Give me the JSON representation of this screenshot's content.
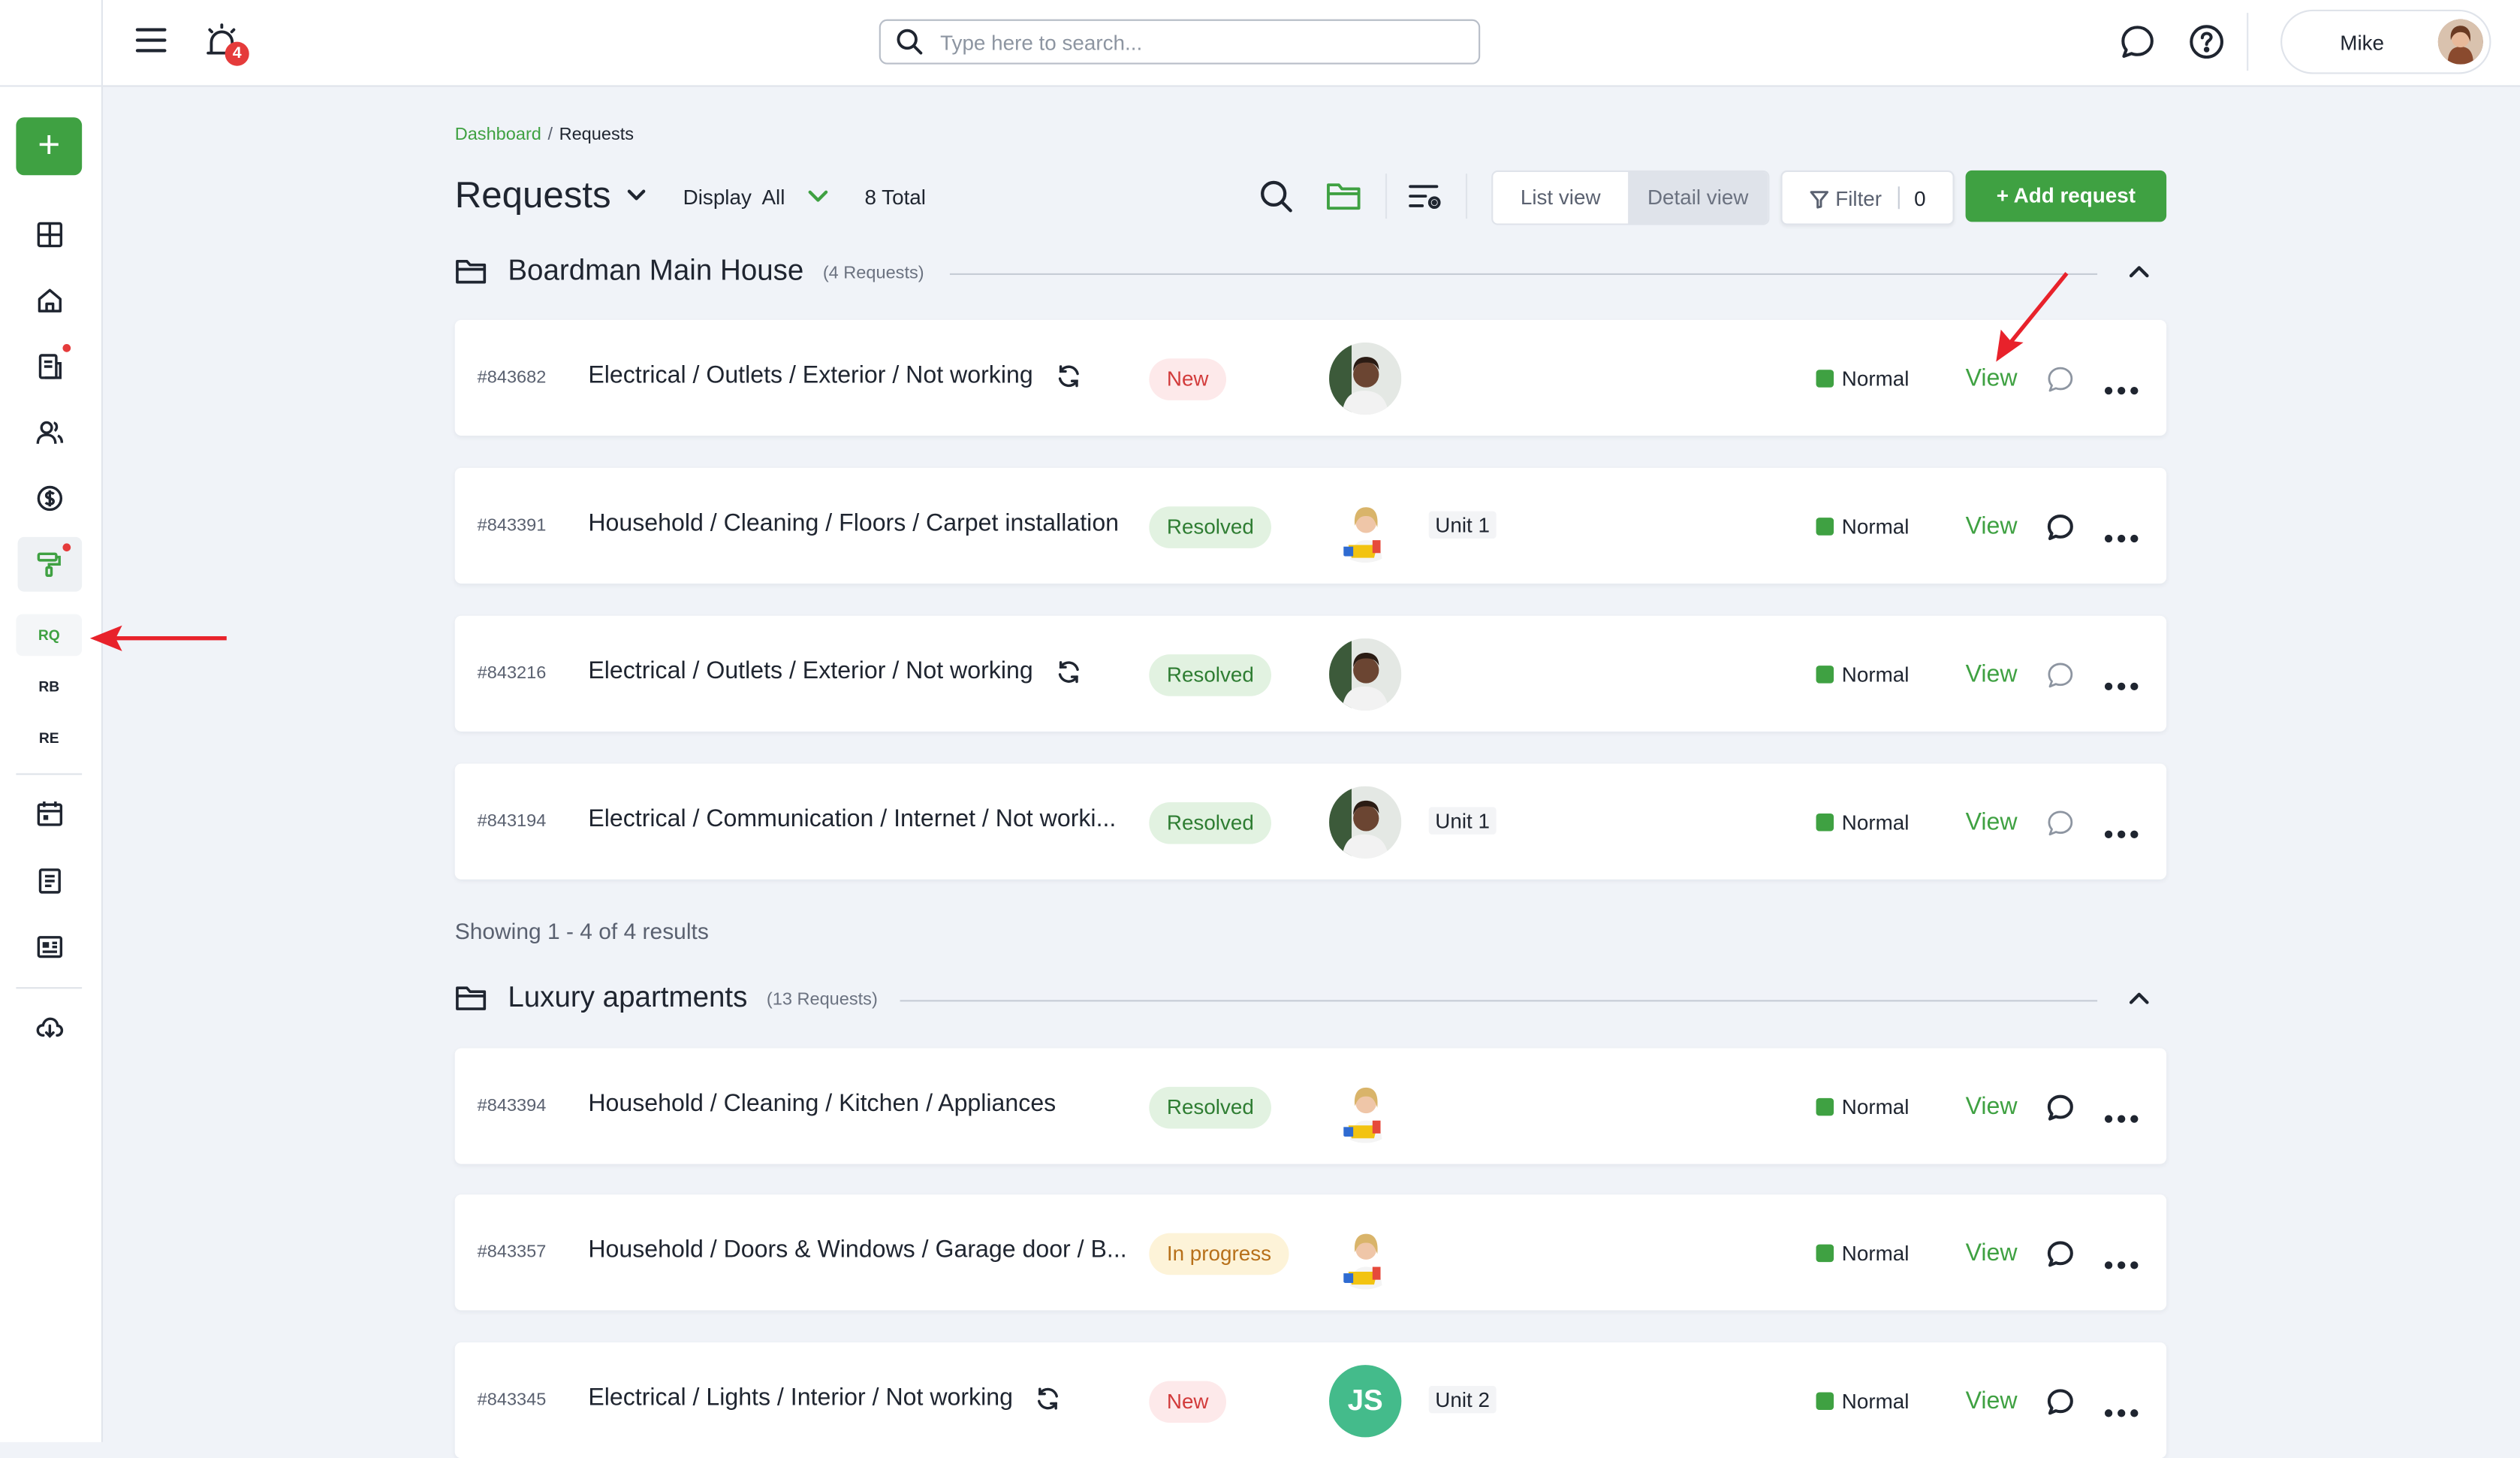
{
  "header": {
    "notification_count": "4",
    "search_placeholder": "Type here to search...",
    "user_name": "Mike"
  },
  "sidebar": {
    "add_label": "+",
    "sub_items": [
      "RQ",
      "RB",
      "RE"
    ],
    "active_sub": "RQ"
  },
  "breadcrumb": {
    "home": "Dashboard",
    "separator": "/",
    "current": "Requests"
  },
  "toolbar": {
    "title": "Requests",
    "display_label": "Display",
    "display_value": "All",
    "total": "8 Total",
    "list_view": "List view",
    "detail_view": "Detail view",
    "filter_label": "Filter",
    "filter_count": "0",
    "add_request": "+ Add request"
  },
  "groups": [
    {
      "name": "Boardman Main House",
      "count": "(4 Requests)",
      "showing": "Showing 1 - 4 of 4 results",
      "rows": [
        {
          "id": "#843682",
          "title": "Electrical / Outlets / Exterior / Not working",
          "status": "New",
          "avatar": "man",
          "unit": "",
          "priority": "Normal",
          "view": "View",
          "comment": "empty",
          "recurring": true
        },
        {
          "id": "#843391",
          "title": "Household / Cleaning / Floors / Carpet installation",
          "status": "Resolved",
          "avatar": "woman",
          "unit": "Unit 1",
          "priority": "Normal",
          "view": "View",
          "comment": "active",
          "recurring": false
        },
        {
          "id": "#843216",
          "title": "Electrical / Outlets / Exterior / Not working",
          "status": "Resolved",
          "avatar": "man",
          "unit": "",
          "priority": "Normal",
          "view": "View",
          "comment": "empty",
          "recurring": true
        },
        {
          "id": "#843194",
          "title": "Electrical / Communication / Internet / Not worki...",
          "status": "Resolved",
          "avatar": "man",
          "unit": "Unit 1",
          "priority": "Normal",
          "view": "View",
          "comment": "empty",
          "recurring": false
        }
      ]
    },
    {
      "name": "Luxury apartments",
      "count": "(13 Requests)",
      "rows": [
        {
          "id": "#843394",
          "title": "Household / Cleaning / Kitchen / Appliances",
          "status": "Resolved",
          "avatar": "woman",
          "unit": "",
          "priority": "Normal",
          "view": "View",
          "comment": "active",
          "recurring": false
        },
        {
          "id": "#843357",
          "title": "Household / Doors & Windows / Garage door / B...",
          "status": "In progress",
          "avatar": "woman",
          "unit": "",
          "priority": "Normal",
          "view": "View",
          "comment": "active",
          "recurring": false
        },
        {
          "id": "#843345",
          "title": "Electrical / Lights / Interior / Not working",
          "status": "New",
          "avatar": "JS",
          "unit": "Unit 2",
          "priority": "Normal",
          "view": "View",
          "comment": "active",
          "recurring": true
        }
      ]
    }
  ],
  "colors": {
    "accent": "#3fa142",
    "background": "#f0f3f8",
    "status_new": "#d23b3b",
    "status_resolved": "#2e7d32",
    "status_in_progress": "#b7701a",
    "annotation_arrow": "#e8222b"
  },
  "icons": [
    "menu-icon",
    "alarm-icon",
    "search-icon",
    "chat-icon",
    "help-icon",
    "folder-icon",
    "sync-icon",
    "comment-icon",
    "more-icon",
    "chevron-up-icon",
    "chevron-down-icon",
    "settings-list-icon",
    "filter-icon",
    "dashboard-icon",
    "home-icon",
    "document-icon",
    "people-icon",
    "dollar-icon",
    "paint-roller-icon",
    "calendar-icon",
    "notes-icon",
    "newspaper-icon",
    "download-cloud-icon"
  ]
}
